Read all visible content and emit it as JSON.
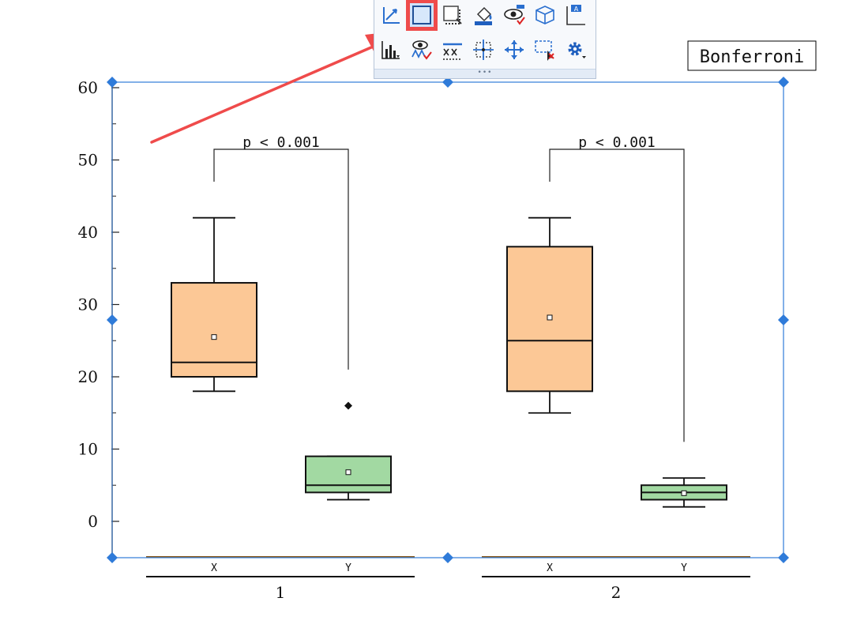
{
  "toolbar": {
    "row1": [
      {
        "name": "axis-icon",
        "selected": false
      },
      {
        "name": "plot-area-frame-icon",
        "selected": true
      },
      {
        "name": "layer-frame-icon",
        "selected": false
      },
      {
        "name": "fill-color-icon",
        "selected": false
      },
      {
        "name": "show-hide-icon",
        "selected": false
      },
      {
        "name": "3d-cube-icon",
        "selected": false
      },
      {
        "name": "text-label-icon",
        "selected": false
      }
    ],
    "row2": [
      {
        "name": "column-plot-icon",
        "selected": false
      },
      {
        "name": "show-data-icon",
        "selected": false
      },
      {
        "name": "axis-break-icon",
        "selected": false
      },
      {
        "name": "crosshair-grid-icon",
        "selected": false
      },
      {
        "name": "move-icon",
        "selected": false
      },
      {
        "name": "region-select-icon",
        "selected": false
      },
      {
        "name": "settings-gear-icon",
        "selected": false
      }
    ],
    "grip": "•••"
  },
  "annotation": {
    "arrow_color": "#ef4b4b",
    "highlight_color": "#ef4b4b"
  },
  "chart_data": {
    "type": "box",
    "ylim": [
      -5,
      60
    ],
    "yticks": [
      0,
      10,
      20,
      30,
      40,
      50,
      60
    ],
    "ytick_labels": [
      "0",
      "10",
      "20",
      "30",
      "40",
      "50",
      "60"
    ],
    "legend_box": "Bonferroni",
    "groups": [
      {
        "label": "1",
        "boxes": [
          {
            "category": "X",
            "color": "#fcc896",
            "whisker_low": 18,
            "q1": 20,
            "median": 22,
            "q3": 33,
            "whisker_high": 42,
            "mean": 25.5,
            "outliers": []
          },
          {
            "category": "Y",
            "color": "#a2d9a2",
            "whisker_low": 3,
            "q1": 4,
            "median": 5,
            "q3": 9,
            "whisker_high": 9,
            "mean": 6.8,
            "outliers": [
              16
            ]
          }
        ],
        "comparison": {
          "label": "p < 0.001",
          "level": 51,
          "left_end": 47,
          "right_end": 21
        }
      },
      {
        "label": "2",
        "boxes": [
          {
            "category": "X",
            "color": "#fcc896",
            "whisker_low": 15,
            "q1": 18,
            "median": 25,
            "q3": 38,
            "whisker_high": 42,
            "mean": 28.2,
            "outliers": []
          },
          {
            "category": "Y",
            "color": "#a2d9a2",
            "whisker_low": 2,
            "q1": 3,
            "median": 4,
            "q3": 5,
            "whisker_high": 6,
            "mean": 3.9,
            "outliers": []
          }
        ],
        "comparison": {
          "label": "p < 0.001",
          "level": 51,
          "left_end": 47,
          "right_end": 11
        }
      }
    ],
    "selection_color": "#2f7bd9"
  }
}
